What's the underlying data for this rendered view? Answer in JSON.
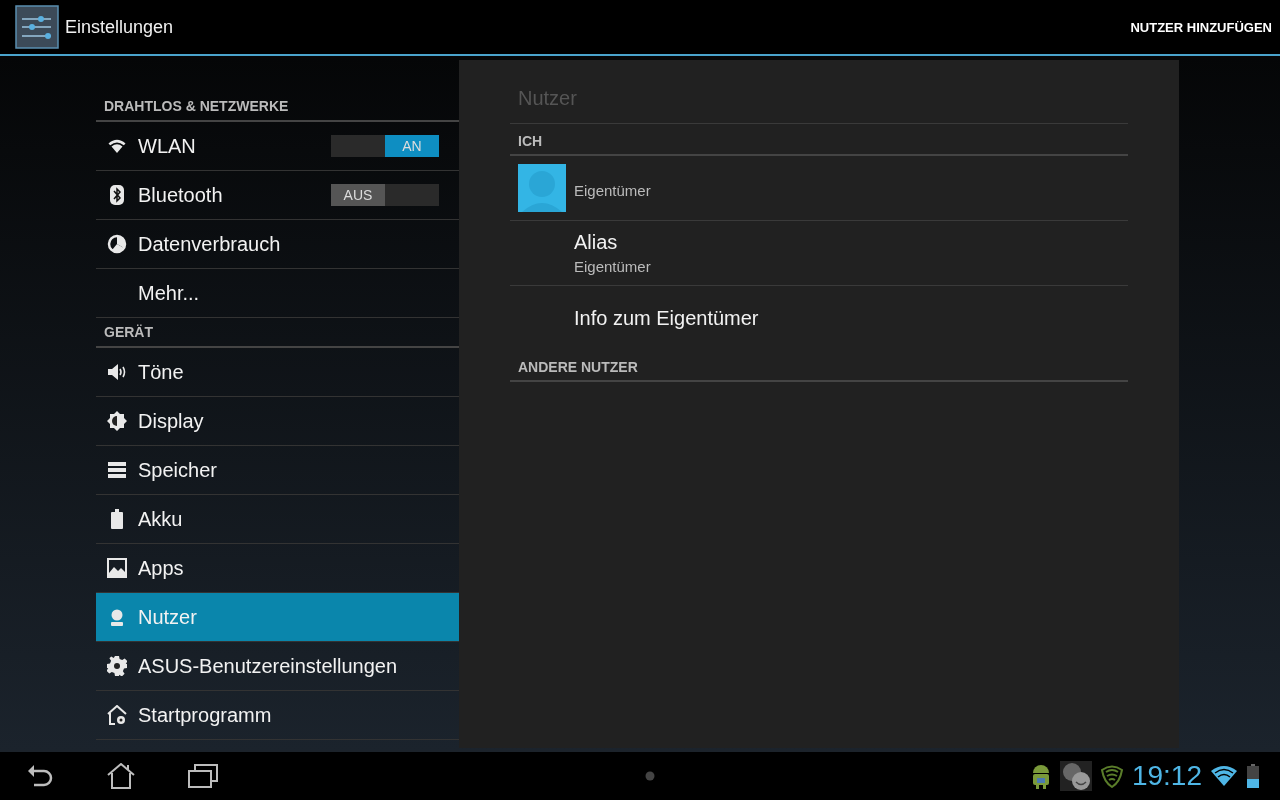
{
  "action_bar": {
    "title": "Einstellungen",
    "action": "NUTZER HINZUFÜGEN"
  },
  "sidebar": {
    "sections": [
      {
        "header": "DRAHTLOS & NETZWERKE",
        "items": [
          {
            "label": "WLAN",
            "kind": "toggle",
            "selected": false,
            "switch": {
              "on": true,
              "label": "AN"
            }
          },
          {
            "label": "Bluetooth",
            "kind": "toggle",
            "selected": false,
            "switch": {
              "on": false,
              "label": "AUS"
            }
          },
          {
            "label": "Datenverbrauch",
            "kind": "plain",
            "selected": false
          },
          {
            "label": "Mehr...",
            "kind": "plain",
            "selected": false
          }
        ]
      },
      {
        "header": "GERÄT",
        "items": [
          {
            "label": "Töne",
            "kind": "plain",
            "selected": false
          },
          {
            "label": "Display",
            "kind": "plain",
            "selected": false
          },
          {
            "label": "Speicher",
            "kind": "plain",
            "selected": false
          },
          {
            "label": "Akku",
            "kind": "plain",
            "selected": false
          },
          {
            "label": "Apps",
            "kind": "plain",
            "selected": false
          },
          {
            "label": "Nutzer",
            "kind": "plain",
            "selected": true
          },
          {
            "label": "ASUS-Benutzereinstellungen",
            "kind": "plain",
            "selected": false
          },
          {
            "label": "Startprogramm",
            "kind": "plain",
            "selected": false
          }
        ]
      }
    ]
  },
  "detail": {
    "title": "Nutzer",
    "sections": [
      {
        "header": "ICH",
        "items": [
          {
            "kind": "avatar",
            "summary": "Eigentümer"
          },
          {
            "kind": "text",
            "title": "Alias",
            "summary": "Eigentümer"
          },
          {
            "kind": "text",
            "title": "Info zum Eigentümer"
          }
        ]
      },
      {
        "header": "ANDERE NUTZER"
      }
    ]
  },
  "nav_bar": {
    "clock": "19:12"
  }
}
